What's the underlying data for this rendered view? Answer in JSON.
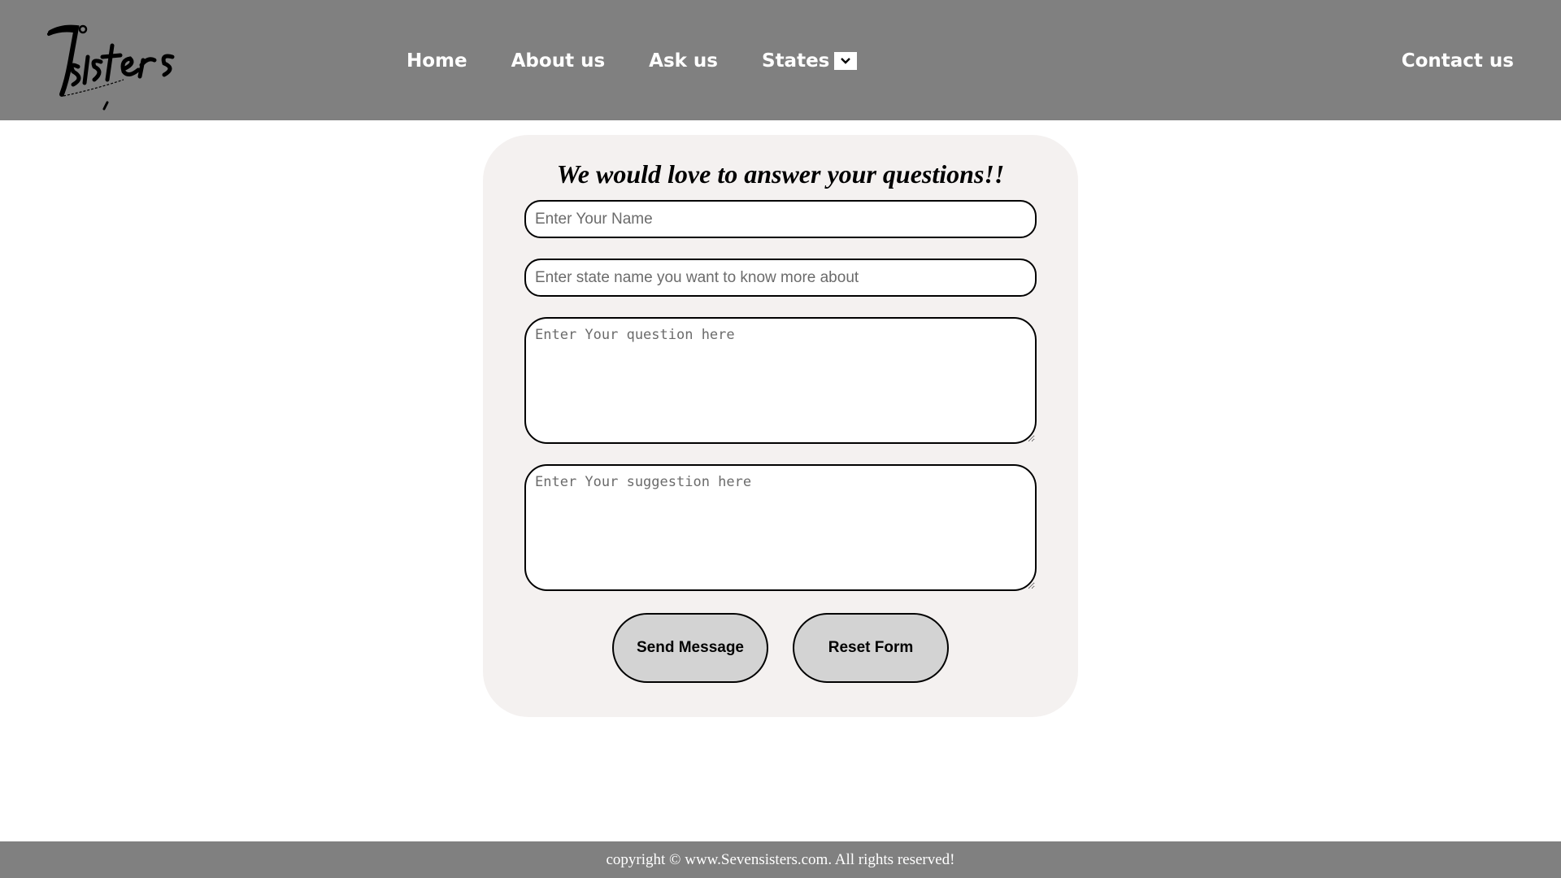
{
  "header": {
    "logo_text": "7sisters",
    "nav": [
      {
        "label": "Home"
      },
      {
        "label": "About us"
      },
      {
        "label": "Ask us"
      },
      {
        "label": "States"
      }
    ],
    "contact_label": "Contact us",
    "bg_color": "#808080"
  },
  "form": {
    "title": "We would love to answer your questions!!",
    "name_placeholder": "Enter Your Name",
    "state_placeholder": "Enter state name you want to know more about",
    "question_placeholder": "Enter Your question here",
    "suggestion_placeholder": "Enter Your suggestion here",
    "send_label": "Send Message",
    "reset_label": "Reset Form",
    "card_color": "#f4f1f0",
    "button_color": "#d3d3d3"
  },
  "footer": {
    "text": "copyright © www.Sevensisters.com. All rights reserved!"
  },
  "icons": {
    "dropdown": "chevron-down-icon",
    "logo": "logo-image"
  }
}
